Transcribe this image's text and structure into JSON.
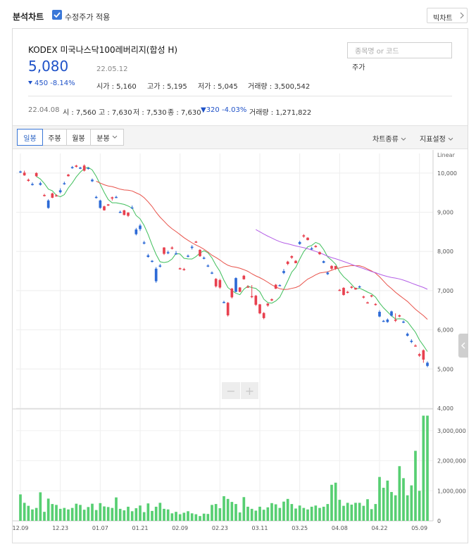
{
  "header": {
    "title": "분석차트",
    "adjusted_price_label": "수정주가 적용",
    "adjusted_price_checked": true,
    "quick_chart_label": "빅차트"
  },
  "stock": {
    "name": "KODEX 미국나스닥100레버리지(합성 H)",
    "price": "5,080",
    "date": "22.05.12",
    "change": "450",
    "change_pct": "-8.14%",
    "direction": "down"
  },
  "quote_stats": [
    {
      "label": "시가",
      "value": "5,160"
    },
    {
      "label": "고가",
      "value": "5,195"
    },
    {
      "label": "저가",
      "value": "5,045"
    },
    {
      "label": "거래량",
      "value": "3,500,542"
    }
  ],
  "search": {
    "placeholder": "종목명 or 코드",
    "kind_label": "주가"
  },
  "history": {
    "date": "22.04.08",
    "open": "시 : 7,560",
    "high": "고 : 7,630",
    "low": "저 : 7,530",
    "close": "종 : 7,630",
    "change": "▼320 -4.03%",
    "volume": "거래량 : 1,271,822"
  },
  "toolbar": {
    "tabs": [
      "일봉",
      "주봉",
      "월봉",
      "분봉"
    ],
    "active_tab": "일봉",
    "chart_type_label": "차트종류",
    "indicator_label": "지표설정"
  },
  "zoom": {
    "minus": "−",
    "plus": "+"
  },
  "colors": {
    "up": "#e8414f",
    "down": "#2d6ad6",
    "ma5": "#3fbf5b",
    "ma20": "#e8524a",
    "ma60": "#b45fe6",
    "volume": "#57cf72",
    "accent": "#3a77d8"
  },
  "chart_data": {
    "type": "candlestick",
    "scale_label": "Linear",
    "price_axis": {
      "ylim": [
        4000,
        10500
      ],
      "ticks": [
        "4,000",
        "5,000",
        "6,000",
        "7,000",
        "8,000",
        "9,000",
        "10,000"
      ]
    },
    "volume_axis": {
      "ylim": [
        0,
        3700000
      ],
      "ticks": [
        "0",
        "1,000,000",
        "2,000,000",
        "3,000,000"
      ]
    },
    "x_ticks": [
      {
        "index": 0,
        "label": "12.09"
      },
      {
        "index": 10,
        "label": "12.23"
      },
      {
        "index": 20,
        "label": "01.07"
      },
      {
        "index": 30,
        "label": "01.21"
      },
      {
        "index": 40,
        "label": "02.09"
      },
      {
        "index": 50,
        "label": "02.23"
      },
      {
        "index": 60,
        "label": "03.11"
      },
      {
        "index": 70,
        "label": "03.25"
      },
      {
        "index": 80,
        "label": "04.08"
      },
      {
        "index": 90,
        "label": "04.22"
      },
      {
        "index": 100,
        "label": "05.09"
      }
    ],
    "candles": [
      [
        10040,
        10060,
        10000,
        10020,
        880000
      ],
      [
        9940,
        10060,
        9930,
        10010,
        600000
      ],
      [
        9800,
        9860,
        9780,
        9830,
        500000
      ],
      [
        9720,
        9760,
        9680,
        9700,
        380000
      ],
      [
        9920,
        10020,
        9900,
        10000,
        430000
      ],
      [
        9740,
        9780,
        9680,
        9700,
        950000
      ],
      [
        9430,
        9470,
        9400,
        9440,
        300000
      ],
      [
        9300,
        9330,
        9090,
        9110,
        740000
      ],
      [
        9370,
        9500,
        9360,
        9480,
        560000
      ],
      [
        9420,
        9460,
        9400,
        9430,
        530000
      ],
      [
        9560,
        9610,
        9480,
        9510,
        400000
      ],
      [
        9740,
        9780,
        9700,
        9720,
        430000
      ],
      [
        9920,
        9980,
        9910,
        9960,
        380000
      ],
      [
        10150,
        10180,
        10110,
        10130,
        430000
      ],
      [
        10160,
        10210,
        10140,
        10190,
        570000
      ],
      [
        10140,
        10160,
        10100,
        10110,
        530000
      ],
      [
        10060,
        10220,
        10040,
        10190,
        370000
      ],
      [
        10130,
        10150,
        10090,
        10110,
        460000
      ],
      [
        9830,
        9860,
        9770,
        9790,
        570000
      ],
      [
        9390,
        9420,
        9350,
        9370,
        360000
      ],
      [
        9300,
        9320,
        9090,
        9110,
        590000
      ],
      [
        9050,
        9170,
        9040,
        9150,
        480000
      ],
      [
        9170,
        9210,
        9160,
        9200,
        460000
      ],
      [
        9350,
        9400,
        9300,
        9380,
        430000
      ],
      [
        9390,
        9420,
        9360,
        9370,
        780000
      ],
      [
        9010,
        9040,
        8990,
        9000,
        400000
      ],
      [
        8930,
        9060,
        8920,
        9050,
        350000
      ],
      [
        8910,
        9000,
        8880,
        8990,
        470000
      ],
      [
        9120,
        9170,
        9090,
        9110,
        320000
      ],
      [
        8560,
        8600,
        8410,
        8440,
        420000
      ],
      [
        8660,
        8700,
        8520,
        8570,
        510000
      ],
      [
        8230,
        8270,
        8180,
        8200,
        290000
      ],
      [
        7900,
        7940,
        7840,
        7860,
        580000
      ],
      [
        7760,
        7780,
        7720,
        7750,
        330000
      ],
      [
        7560,
        7600,
        7200,
        7240,
        470000
      ],
      [
        7640,
        7680,
        7590,
        7630,
        600000
      ],
      [
        7940,
        8110,
        7910,
        8100,
        400000
      ],
      [
        7980,
        8020,
        7930,
        7960,
        380000
      ],
      [
        8070,
        8130,
        8050,
        8100,
        250000
      ],
      [
        7950,
        8010,
        7920,
        7940,
        300000
      ],
      [
        7560,
        7590,
        7540,
        7570,
        220000
      ],
      [
        7540,
        7580,
        7510,
        7550,
        270000
      ],
      [
        7890,
        7920,
        7850,
        7880,
        320000
      ],
      [
        8120,
        8160,
        8050,
        8090,
        250000
      ],
      [
        8240,
        8270,
        8220,
        8250,
        220000
      ],
      [
        7880,
        8060,
        7860,
        8040,
        160000
      ],
      [
        7840,
        7870,
        7800,
        7820,
        240000
      ],
      [
        7640,
        7670,
        7600,
        7630,
        230000
      ],
      [
        7460,
        7490,
        7420,
        7440,
        530000
      ],
      [
        7110,
        7320,
        7080,
        7300,
        560000
      ],
      [
        7080,
        7300,
        7050,
        7270,
        420000
      ],
      [
        6710,
        6740,
        6680,
        6690,
        820000
      ],
      [
        6370,
        6710,
        6340,
        6690,
        730000
      ],
      [
        6830,
        7070,
        6800,
        7050,
        630000
      ],
      [
        7320,
        7340,
        6960,
        6970,
        560000
      ],
      [
        6970,
        7090,
        6960,
        7080,
        280000
      ],
      [
        7290,
        7400,
        7280,
        7380,
        790000
      ],
      [
        7100,
        7140,
        7080,
        7100,
        470000
      ],
      [
        6840,
        7140,
        6810,
        6860,
        400000
      ],
      [
        6640,
        6890,
        6610,
        6870,
        340000
      ],
      [
        6420,
        6660,
        6400,
        6650,
        470000
      ],
      [
        6300,
        6450,
        6270,
        6430,
        370000
      ],
      [
        6620,
        6680,
        6590,
        6670,
        450000
      ],
      [
        6750,
        6800,
        6730,
        6780,
        590000
      ],
      [
        7050,
        7170,
        7040,
        7150,
        550000
      ],
      [
        7140,
        7160,
        7120,
        7130,
        430000
      ],
      [
        7500,
        7550,
        7420,
        7450,
        640000
      ],
      [
        7680,
        7760,
        7650,
        7740,
        730000
      ],
      [
        7840,
        7900,
        7810,
        7880,
        560000
      ],
      [
        7700,
        7780,
        7700,
        7760,
        410000
      ],
      [
        8240,
        8270,
        8170,
        8190,
        510000
      ],
      [
        8380,
        8440,
        8350,
        8410,
        430000
      ],
      [
        8290,
        8360,
        8280,
        8350,
        380000
      ],
      [
        8080,
        8120,
        8040,
        8060,
        470000
      ],
      [
        8110,
        8160,
        8100,
        8140,
        510000
      ],
      [
        7930,
        8000,
        7910,
        7980,
        430000
      ],
      [
        7750,
        7770,
        7700,
        7710,
        470000
      ],
      [
        7460,
        7490,
        7400,
        7420,
        560000
      ],
      [
        7560,
        7650,
        7530,
        7630,
        1200000
      ],
      [
        7560,
        7630,
        7530,
        7630,
        1270000
      ],
      [
        7010,
        7040,
        6990,
        7020,
        700000
      ],
      [
        6890,
        7090,
        6870,
        7070,
        500000
      ],
      [
        6950,
        6990,
        6930,
        6970,
        600000
      ],
      [
        7080,
        7120,
        7050,
        7100,
        540000
      ],
      [
        7030,
        7080,
        7020,
        7070,
        600000
      ],
      [
        7110,
        7130,
        7070,
        7090,
        600000
      ],
      [
        6830,
        6870,
        6800,
        6850,
        500000
      ],
      [
        6690,
        6720,
        6670,
        6700,
        720000
      ],
      [
        6850,
        6890,
        6830,
        6880,
        390000
      ],
      [
        6640,
        6680,
        6620,
        6660,
        560000
      ],
      [
        6460,
        6500,
        6320,
        6340,
        1460000
      ],
      [
        6230,
        6250,
        6200,
        6220,
        1100000
      ],
      [
        6260,
        6290,
        6180,
        6200,
        1340000
      ],
      [
        6470,
        6490,
        6340,
        6360,
        960000
      ],
      [
        6230,
        6420,
        6200,
        6260,
        850000
      ],
      [
        6340,
        6390,
        6320,
        6370,
        1820000
      ],
      [
        6210,
        6240,
        6170,
        6190,
        1420000
      ],
      [
        5900,
        5930,
        5830,
        5850,
        850000
      ],
      [
        5720,
        5760,
        5660,
        5690,
        1180000
      ],
      [
        5590,
        5630,
        5570,
        5600,
        2330000
      ],
      [
        5340,
        5410,
        5310,
        5380,
        1000000
      ],
      [
        5240,
        5500,
        5160,
        5480,
        3500000
      ],
      [
        5160,
        5195,
        5045,
        5080,
        3500542
      ]
    ]
  }
}
